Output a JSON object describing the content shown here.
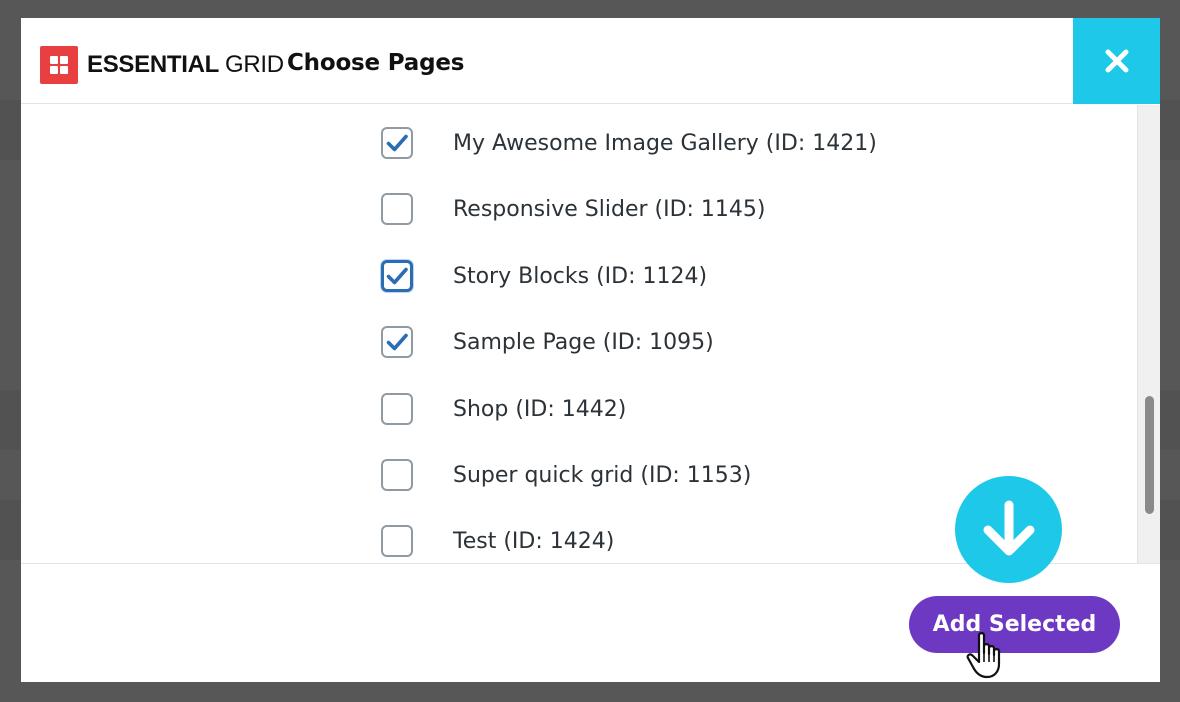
{
  "modal": {
    "logo_primary": "ESSENTIAL",
    "logo_secondary": "GRID",
    "title": "Choose Pages",
    "close_icon": "close-icon"
  },
  "pages": [
    {
      "label": "My Awesome Image Gallery (ID: 1421)",
      "checked": true,
      "focused": false
    },
    {
      "label": "Responsive Slider (ID: 1145)",
      "checked": false,
      "focused": false
    },
    {
      "label": "Story Blocks (ID: 1124)",
      "checked": true,
      "focused": true
    },
    {
      "label": "Sample Page (ID: 1095)",
      "checked": true,
      "focused": false
    },
    {
      "label": "Shop (ID: 1442)",
      "checked": false,
      "focused": false
    },
    {
      "label": "Super quick grid (ID: 1153)",
      "checked": false,
      "focused": false
    },
    {
      "label": "Test (ID: 1424)",
      "checked": false,
      "focused": false
    }
  ],
  "footer": {
    "add_label": "Add Selected"
  },
  "colors": {
    "accent_cyan": "#1ec8e8",
    "button_purple": "#6d38c2",
    "logo_red": "#e84040",
    "check_blue": "#2b6db3"
  },
  "annotation": {
    "arrow_icon": "arrow-down-icon",
    "cursor_icon": "hand-pointer-icon"
  }
}
